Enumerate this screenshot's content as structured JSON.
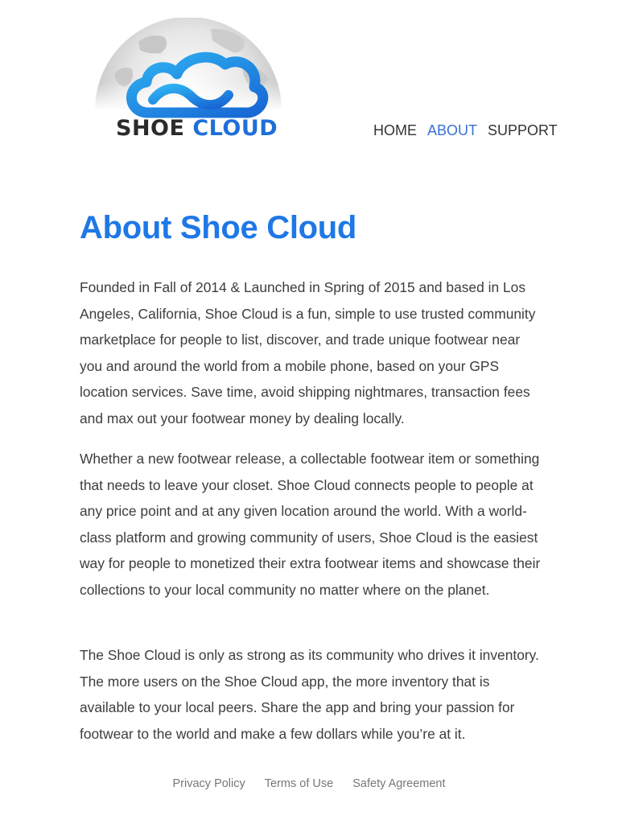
{
  "brand": {
    "logo_word_1": "SHOE",
    "logo_word_2": "CLOUD",
    "primary_color": "#1e78e6",
    "text_color": "#2b2b2b"
  },
  "nav": {
    "items": [
      {
        "label": "HOME",
        "active": false
      },
      {
        "label": "ABOUT",
        "active": true
      },
      {
        "label": "SUPPORT",
        "active": false
      }
    ]
  },
  "main": {
    "title": "About Shoe Cloud",
    "paragraphs": [
      "Founded in Fall of 2014 & Launched in Spring of 2015 and based in Los Angeles, California, Shoe Cloud is a fun, simple to use trusted community marketplace for people to list, discover, and trade unique footwear near you and around the world from a mobile phone, based on your GPS location services. Save time, avoid shipping nightmares, transaction fees and max out your footwear money by dealing locally.",
      "Whether a new footwear release, a collectable footwear item or something that needs to leave your closet. Shoe Cloud connects people to people at any price point and at any given location around the world. With a world-class platform and growing community of users, Shoe Cloud is the easiest way for people to monetized their extra footwear items and showcase their collections to your local community no matter where on the planet.",
      "The Shoe Cloud is only as strong as its community who drives it inventory. The more users on the Shoe Cloud app, the more inventory that is available to your local peers. Share the app and bring your passion for footwear to the world and make a few dollars while you’re at it."
    ]
  },
  "footer": {
    "links": [
      "Privacy Policy",
      "Terms of Use",
      "Safety Agreement"
    ]
  }
}
